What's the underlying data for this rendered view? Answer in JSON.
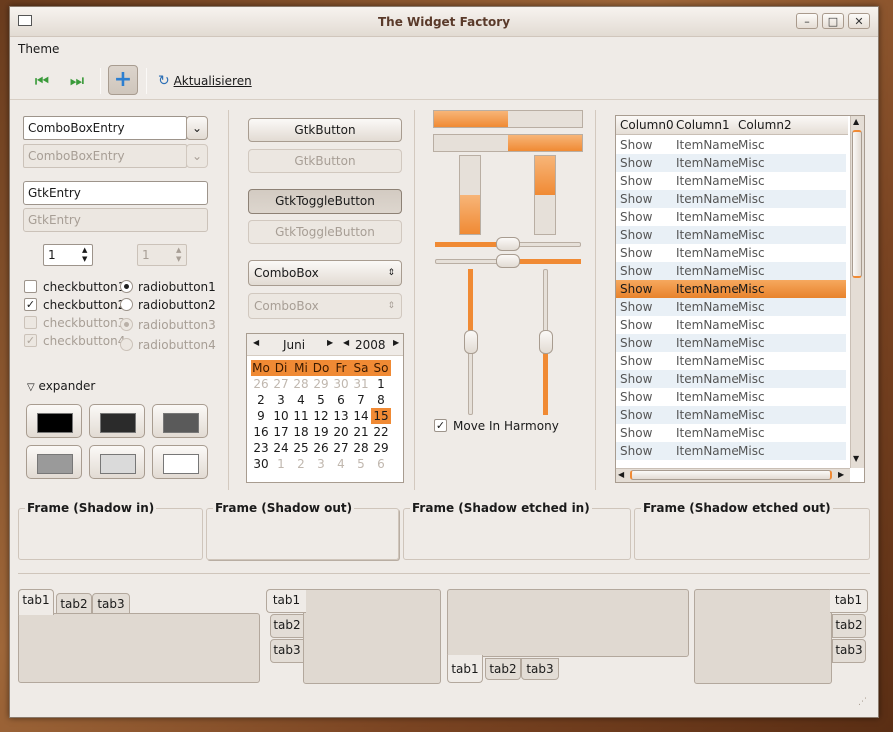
{
  "window": {
    "title": "The Widget Factory"
  },
  "menu": {
    "theme": "Theme"
  },
  "toolbar": {
    "refresh_label": "Aktualisieren"
  },
  "combo_entry": {
    "value": "ComboBoxEntry",
    "disabled_value": "ComboBoxEntry"
  },
  "entry": {
    "value": "GtkEntry",
    "disabled_value": "GtkEntry"
  },
  "spin": {
    "value": "1",
    "disabled_value": "1"
  },
  "checks": [
    {
      "label": "checkbutton1",
      "checked": false,
      "disabled": false
    },
    {
      "label": "checkbutton2",
      "checked": true,
      "disabled": false
    },
    {
      "label": "checkbutton3",
      "checked": false,
      "disabled": true
    },
    {
      "label": "checkbutton4",
      "checked": true,
      "disabled": true
    }
  ],
  "radios": [
    {
      "label": "radiobutton1",
      "selected": true,
      "disabled": false
    },
    {
      "label": "radiobutton2",
      "selected": false,
      "disabled": false
    },
    {
      "label": "radiobutton3",
      "selected": true,
      "disabled": true
    },
    {
      "label": "radiobutton4",
      "selected": false,
      "disabled": true
    }
  ],
  "expander": {
    "label": "expander"
  },
  "color_swatches": [
    "#000000",
    "#2b2b2b",
    "#5a5a5a",
    "#9a9a9a",
    "#dadada",
    "#ffffff"
  ],
  "buttons": {
    "button": "GtkButton",
    "button_disabled": "GtkButton",
    "toggle": "GtkToggleButton",
    "toggle_disabled": "GtkToggleButton",
    "combo": "ComboBox",
    "combo_disabled": "ComboBox"
  },
  "calendar": {
    "month": "Juni",
    "year": "2008",
    "weekdays": [
      "Mo",
      "Di",
      "Mi",
      "Do",
      "Fr",
      "Sa",
      "So"
    ],
    "rows": [
      [
        "26",
        "27",
        "28",
        "29",
        "30",
        "31",
        "1"
      ],
      [
        "2",
        "3",
        "4",
        "5",
        "6",
        "7",
        "8"
      ],
      [
        "9",
        "10",
        "11",
        "12",
        "13",
        "14",
        "15"
      ],
      [
        "16",
        "17",
        "18",
        "19",
        "20",
        "21",
        "22"
      ],
      [
        "23",
        "24",
        "25",
        "26",
        "27",
        "28",
        "29"
      ],
      [
        "30",
        "1",
        "2",
        "3",
        "4",
        "5",
        "6"
      ]
    ],
    "selected_day": "15",
    "accent": "#f08a34"
  },
  "progress": {
    "h1": 0.5,
    "h2": 0.5,
    "v1": 0.5,
    "v2": 0.5
  },
  "sliders": {
    "h1": 0.5,
    "h2": 0.5,
    "v1": 0.5,
    "v2": 0.5
  },
  "move_in_harmony": {
    "label": "Move In Harmony",
    "checked": true
  },
  "tree": {
    "columns": [
      "Column0",
      "Column1",
      "Column2"
    ],
    "rows": [
      [
        "Show",
        "ItemName",
        "Misc"
      ],
      [
        "Show",
        "ItemName",
        "Misc"
      ],
      [
        "Show",
        "ItemName",
        "Misc"
      ],
      [
        "Show",
        "ItemName",
        "Misc"
      ],
      [
        "Show",
        "ItemName",
        "Misc"
      ],
      [
        "Show",
        "ItemName",
        "Misc"
      ],
      [
        "Show",
        "ItemName",
        "Misc"
      ],
      [
        "Show",
        "ItemName",
        "Misc"
      ],
      [
        "Show",
        "ItemName",
        "Misc"
      ],
      [
        "Show",
        "ItemName",
        "Misc"
      ],
      [
        "Show",
        "ItemName",
        "Misc"
      ],
      [
        "Show",
        "ItemName",
        "Misc"
      ],
      [
        "Show",
        "ItemName",
        "Misc"
      ],
      [
        "Show",
        "ItemName",
        "Misc"
      ],
      [
        "Show",
        "ItemName",
        "Misc"
      ],
      [
        "Show",
        "ItemName",
        "Misc"
      ],
      [
        "Show",
        "ItemName",
        "Misc"
      ],
      [
        "Show",
        "ItemName",
        "Misc"
      ]
    ],
    "selected_index": 8
  },
  "frames": [
    "Frame (Shadow in)",
    "Frame (Shadow out)",
    "Frame (Shadow etched in)",
    "Frame (Shadow etched out)"
  ],
  "notebooks": {
    "tabs": [
      "tab1",
      "tab2",
      "tab3"
    ]
  }
}
